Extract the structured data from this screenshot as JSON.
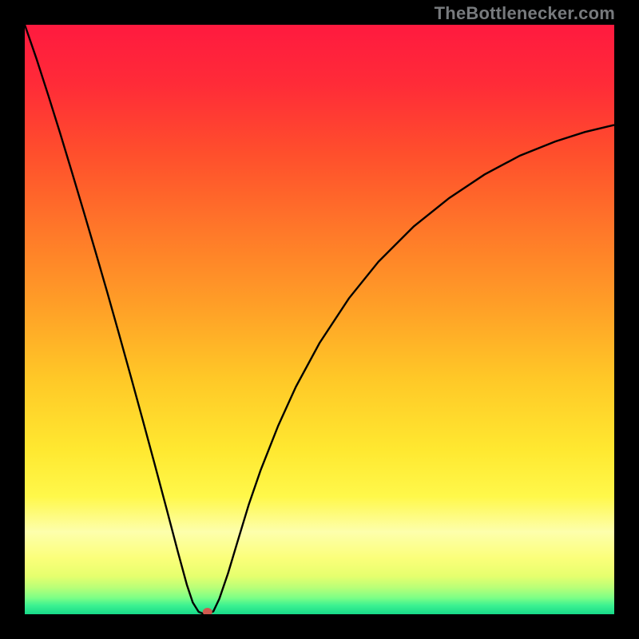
{
  "watermark": "TheBottlenecker.com",
  "chart_data": {
    "type": "line",
    "title": "",
    "xlabel": "",
    "ylabel": "",
    "xlim": [
      0,
      100
    ],
    "ylim": [
      0,
      100
    ],
    "background": {
      "type": "vertical-gradient",
      "stops": [
        {
          "offset": 0.0,
          "color": "#ff1a3f"
        },
        {
          "offset": 0.1,
          "color": "#ff2b38"
        },
        {
          "offset": 0.22,
          "color": "#ff4f2c"
        },
        {
          "offset": 0.35,
          "color": "#ff7829"
        },
        {
          "offset": 0.48,
          "color": "#ffa027"
        },
        {
          "offset": 0.6,
          "color": "#ffc827"
        },
        {
          "offset": 0.72,
          "color": "#ffe830"
        },
        {
          "offset": 0.8,
          "color": "#fff84a"
        },
        {
          "offset": 0.86,
          "color": "#fdffac"
        },
        {
          "offset": 0.905,
          "color": "#fbff7a"
        },
        {
          "offset": 0.935,
          "color": "#e6ff6e"
        },
        {
          "offset": 0.955,
          "color": "#b8ff78"
        },
        {
          "offset": 0.972,
          "color": "#7dff86"
        },
        {
          "offset": 0.985,
          "color": "#3cf291"
        },
        {
          "offset": 1.0,
          "color": "#17d989"
        }
      ]
    },
    "series": [
      {
        "name": "curve",
        "color": "#000000",
        "stroke_width": 2.4,
        "x": [
          0,
          2,
          4,
          6,
          8,
          10,
          12,
          14,
          16,
          18,
          20,
          22,
          24,
          26,
          27.5,
          28.5,
          29.5,
          30.5,
          31,
          32,
          33,
          34.5,
          36,
          38,
          40,
          43,
          46,
          50,
          55,
          60,
          66,
          72,
          78,
          84,
          90,
          95,
          100
        ],
        "y": [
          100,
          94.2,
          88.0,
          81.6,
          75.0,
          68.3,
          61.5,
          54.6,
          47.5,
          40.3,
          33.0,
          25.6,
          18.1,
          10.5,
          5.0,
          2.0,
          0.4,
          0.0,
          0.0,
          0.5,
          2.6,
          7.0,
          12.0,
          18.6,
          24.4,
          32.0,
          38.6,
          46.0,
          53.6,
          59.8,
          65.8,
          70.6,
          74.6,
          77.8,
          80.2,
          81.8,
          83.0
        ]
      }
    ],
    "marker": {
      "name": "dot",
      "x": 31.0,
      "y": 0.4,
      "rx": 6,
      "ry": 5,
      "fill": "#cf594f"
    }
  }
}
